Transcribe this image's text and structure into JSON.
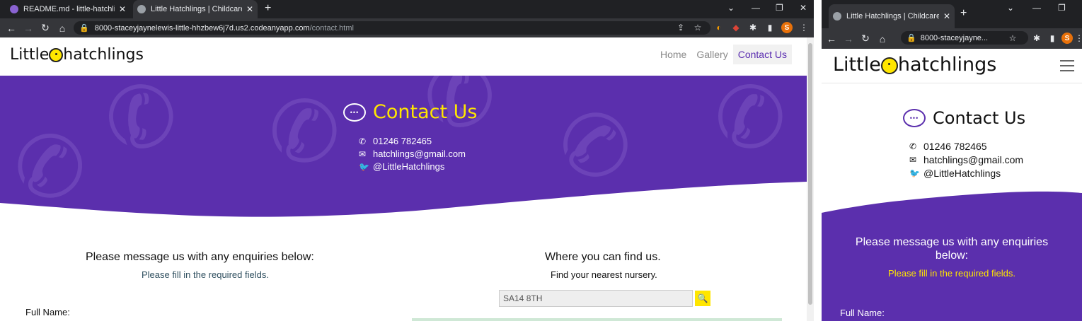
{
  "colors": {
    "purple": "#5b2fad",
    "yellow": "#ffe600",
    "navActive": "#5a2db0"
  },
  "left": {
    "tabs": [
      {
        "title": "README.md - little-hatchlings - C",
        "icon": "github-icon"
      },
      {
        "title": "Little Hatchlings | Childcare Nurs",
        "icon": "globe-icon"
      }
    ],
    "url": {
      "host": "8000-staceyjaynelewis-little-hhzbew6j7d.us2.codeanyapp.com",
      "path": "/contact.html"
    },
    "logo": {
      "part1": "Little",
      "part2": "hatchlings"
    },
    "nav": [
      "Home",
      "Gallery",
      "Contact Us"
    ],
    "hero": {
      "title": "Contact Us",
      "phone": "01246 782465",
      "email": "hatchlings@gmail.com",
      "twitter": "@LittleHatchlings"
    },
    "form": {
      "heading": "Please message us with any enquiries below:",
      "sub": "Please fill in the required fields.",
      "full_name": "Full Name:"
    },
    "map": {
      "heading": "Where you can find us.",
      "sub": "Find your nearest nursery.",
      "search_value": "SA14 8TH"
    }
  },
  "right": {
    "tab": {
      "title": "Little Hatchlings | Childcare N",
      "icon": "globe-icon"
    },
    "url": "8000-staceyjayne...",
    "logo": {
      "part1": "Little",
      "part2": "hatchlings"
    },
    "contact": {
      "title": "Contact Us",
      "phone": "01246 782465",
      "email": "hatchlings@gmail.com",
      "twitter": "@LittleHatchlings"
    },
    "form": {
      "heading_line1": "Please message us with any enquiries",
      "heading_line2": "below:",
      "sub": "Please fill in the required fields.",
      "full_name": "Full Name:"
    }
  }
}
